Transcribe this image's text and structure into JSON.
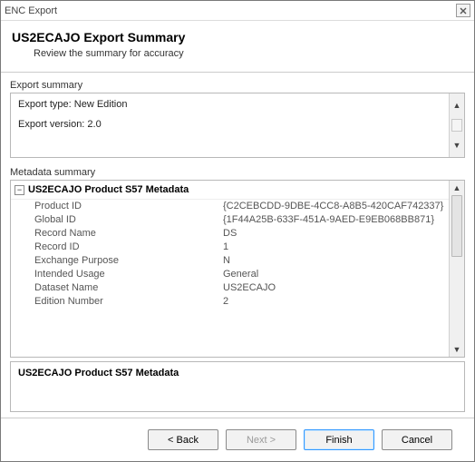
{
  "window": {
    "title": "ENC Export"
  },
  "header": {
    "title": "US2ECAJO Export Summary",
    "subtitle": "Review the summary for accuracy"
  },
  "export_summary": {
    "section_label": "Export summary",
    "rows": [
      {
        "label": "Export type: ",
        "value": "New Edition"
      },
      {
        "label": "Export version: ",
        "value": "2.0"
      }
    ]
  },
  "metadata_summary": {
    "section_label": "Metadata summary",
    "group_title": "US2ECAJO Product S57 Metadata",
    "rows": [
      {
        "label": "Product ID",
        "value": "{C2CEBCDD-9DBE-4CC8-A8B5-420CAF742337}"
      },
      {
        "label": "Global ID",
        "value": "{1F44A25B-633F-451A-9AED-E9EB068BB871}"
      },
      {
        "label": "Record Name",
        "value": "DS"
      },
      {
        "label": "Record ID",
        "value": "1"
      },
      {
        "label": "Exchange Purpose",
        "value": "N"
      },
      {
        "label": "Intended Usage",
        "value": "General"
      },
      {
        "label": "Dataset Name",
        "value": "US2ECAJO"
      },
      {
        "label": "Edition Number",
        "value": "2"
      }
    ],
    "detail_title": "US2ECAJO Product S57 Metadata"
  },
  "buttons": {
    "back": "< Back",
    "next": "Next >",
    "finish": "Finish",
    "cancel": "Cancel"
  }
}
